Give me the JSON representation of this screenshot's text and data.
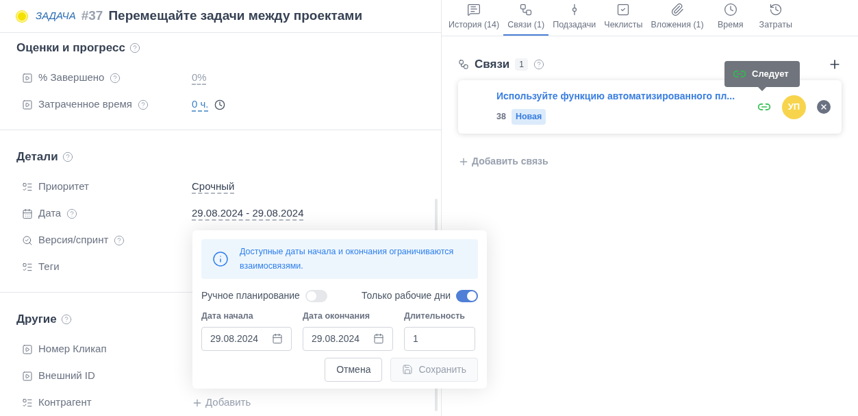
{
  "task": {
    "type_label": "ЗАДАЧА",
    "number": "#37",
    "title": "Перемещайте задачи между проектами"
  },
  "sections": [
    {
      "title": "Оценки и прогресс",
      "help": true,
      "fields": [
        {
          "label": "% Завершено",
          "help": true,
          "value": "0%",
          "kind": "faint"
        },
        {
          "label": "Затраченное время",
          "help": true,
          "value": "0 ч.",
          "kind": "time"
        }
      ]
    },
    {
      "title": "Детали",
      "help": true,
      "fields": [
        {
          "label": "Приоритет",
          "help": false,
          "value": "Срочный",
          "kind": "plain"
        },
        {
          "label": "Дата",
          "help": true,
          "value": "29.08.2024 - 29.08.2024",
          "kind": "plain"
        },
        {
          "label": "Версия/спринт",
          "help": true
        },
        {
          "label": "Теги",
          "help": false
        }
      ]
    },
    {
      "title": "Другие",
      "help": true,
      "fields": [
        {
          "label": "Номер Кликап",
          "help": false
        },
        {
          "label": "Внешний ID",
          "help": false
        },
        {
          "label": "Контрагент",
          "help": false,
          "value": "Добавить",
          "kind": "add"
        }
      ]
    }
  ],
  "tabs": [
    {
      "label": "История (14)",
      "selected": false
    },
    {
      "label": "Связи (1)",
      "selected": true
    },
    {
      "label": "Подзадачи",
      "selected": false
    },
    {
      "label": "Чеклисты",
      "selected": false
    },
    {
      "label": "Вложения (1)",
      "selected": false
    },
    {
      "label": "Время",
      "selected": false
    },
    {
      "label": "Затраты",
      "selected": false
    }
  ],
  "relations": {
    "title": "Связи",
    "count": "1",
    "items": [
      {
        "title": "Используйте функцию автоматизированного пл...",
        "number": "38",
        "status": "Новая",
        "avatar": "УП"
      }
    ],
    "tooltip": "Следует",
    "add_label": "Добавить связь"
  },
  "popup": {
    "info": "Доступные даты начала и окончания ограничиваются взаимосвязями.",
    "toggles": [
      {
        "label": "Ручное планирование",
        "on": false
      },
      {
        "label": "Только рабочие дни",
        "on": true
      }
    ],
    "inputs": [
      {
        "label": "Дата начала",
        "value": "29.08.2024",
        "kind": "date"
      },
      {
        "label": "Дата окончания",
        "value": "29.08.2024",
        "kind": "date"
      },
      {
        "label": "Длительность",
        "value": "1",
        "kind": "number"
      }
    ],
    "buttons": [
      {
        "label": "Отмена",
        "disabled": false
      },
      {
        "label": "Сохранить",
        "disabled": true
      }
    ]
  }
}
